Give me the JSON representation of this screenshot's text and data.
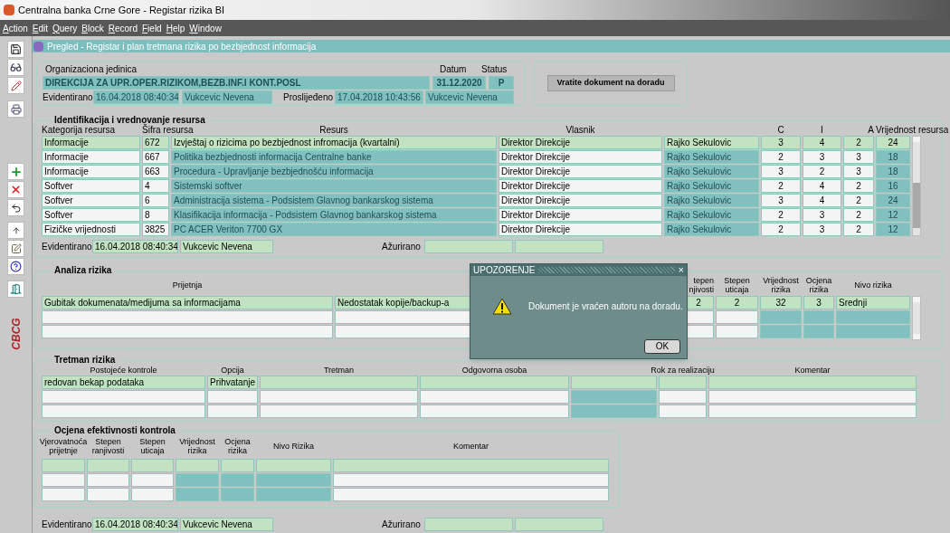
{
  "window": {
    "title": "Centralna banka Crne Gore - Registar rizika BI"
  },
  "menu": [
    "Action",
    "Edit",
    "Query",
    "Block",
    "Record",
    "Field",
    "Help",
    "Window"
  ],
  "side_logo": "CBCG",
  "form": {
    "title": "Pregled - Registar i plan tretmana rizika po bezbjednost informacija"
  },
  "header": {
    "org_label": "Organizaciona jedinica",
    "org_value": "DIREKCIJA ZA UPR.OPER.RIZIKOM,BEZB.INF.I KONT.POSL",
    "date_label": "Datum",
    "date_value": "31.12.2020",
    "status_label": "Status",
    "status_value": "P",
    "recorded_label": "Evidentirano",
    "recorded_at": "16.04.2018 08:40:34",
    "recorded_by": "Vukcevic Nevena",
    "forwarded_label": "Proslijeđeno",
    "forwarded_at": "17.04.2018 10:43:56",
    "forwarded_by": "Vukcevic Nevena"
  },
  "return_button": "Vratite dokument na doradu",
  "resources": {
    "title": "Identifikacija i vrednovanje resursa",
    "columns": [
      {
        "label": "Kategorija resursa",
        "readonly": false
      },
      {
        "label": "Šifra resursa",
        "readonly": false
      },
      {
        "label": "Resurs",
        "readonly": true
      },
      {
        "label": "Vlasnik",
        "readonly": false
      },
      {
        "readonly": true
      },
      {
        "label": "C",
        "readonly": false
      },
      {
        "label": "I",
        "readonly": false
      },
      {
        "label": "A",
        "readonly": false
      },
      {
        "label": "Vrijednost resursa",
        "readonly": true
      }
    ],
    "rows": [
      {
        "selected": true,
        "cells": [
          "Informacije",
          "672",
          "Izvještaj o rizicima po bezbjednost infromacija (kvartalni)",
          "Direktor Direkcije",
          "Rajko Sekulovic",
          "3",
          "4",
          "2",
          "24"
        ]
      },
      {
        "selected": false,
        "cells": [
          "Informacije",
          "667",
          "Politika bezbjednosti informacija Centralne banke",
          "Direktor Direkcije",
          "Rajko Sekulovic",
          "2",
          "3",
          "3",
          "18"
        ]
      },
      {
        "selected": false,
        "cells": [
          "Informacije",
          "663",
          "Procedura - Upravljanje bezbjednošću informacija",
          "Direktor Direkcije",
          "Rajko Sekulovic",
          "3",
          "2",
          "3",
          "18"
        ]
      },
      {
        "selected": false,
        "cells": [
          "Softver",
          "4",
          "Sistemski softver",
          "Direktor Direkcije",
          "Rajko Sekulovic",
          "2",
          "4",
          "2",
          "16"
        ]
      },
      {
        "selected": false,
        "cells": [
          "Softver",
          "6",
          "Administracija sistema - Podsistem Glavnog bankarskog sistema",
          "Direktor Direkcije",
          "Rajko Sekulovic",
          "3",
          "4",
          "2",
          "24"
        ]
      },
      {
        "selected": false,
        "cells": [
          "Softver",
          "8",
          "Klasifikacija informacija - Podsistem Glavnog bankarskog sistema",
          "Direktor Direkcije",
          "Rajko Sekulovic",
          "2",
          "3",
          "2",
          "12"
        ]
      },
      {
        "selected": false,
        "cells": [
          "Fizičke vrijednosti",
          "3825",
          "PC ACER Veriton 7700 GX",
          "Direktor Direkcije",
          "Rajko Sekulovic",
          "2",
          "3",
          "2",
          "12"
        ]
      }
    ],
    "footer": {
      "recorded_label": "Evidentirano",
      "recorded_at": "16.04.2018 08:40:34",
      "recorded_by": "Vukcevic Nevena",
      "updated_label": "Ažurirano"
    }
  },
  "analysis": {
    "title": "Analiza rizika",
    "columns": [
      {
        "label": [
          "Prijetnja"
        ],
        "readonly": false
      },
      {
        "readonly": false
      },
      {
        "label": [
          "tepen",
          "njivosti"
        ],
        "readonly": false
      },
      {
        "label": [
          "Stepen",
          "uticaja"
        ],
        "readonly": false
      },
      {
        "label": [
          "Vrijednost",
          "rizika"
        ],
        "readonly": true
      },
      {
        "label": [
          "Ocjena",
          "rizika"
        ],
        "readonly": true
      },
      {
        "label": [
          "Nivo rizika"
        ],
        "readonly": true
      }
    ],
    "rows": [
      {
        "selected": true,
        "cells": [
          "Gubitak dokumenata/medijuma sa informacijama",
          "Nedostatak kopije/backup-a",
          "2",
          "2",
          "32",
          "3",
          "Srednji"
        ]
      },
      {
        "selected": false,
        "cells": [
          "",
          "",
          "",
          "",
          "",
          "",
          ""
        ]
      },
      {
        "selected": false,
        "cells": [
          "",
          "",
          "",
          "",
          "",
          "",
          ""
        ]
      }
    ]
  },
  "treatment": {
    "title": "Tretman rizika",
    "columns": [
      {
        "label": "Postojeće kontrole",
        "readonly": false
      },
      {
        "label": "Opcija",
        "readonly": false
      },
      {
        "label": "Tretman",
        "readonly": false
      },
      {
        "label": "Odgovorna osoba",
        "readonly": false
      },
      {
        "readonly": true
      },
      {
        "label": "Rok za realizaciju",
        "readonly": false
      },
      {
        "label": "Komentar",
        "readonly": false
      }
    ],
    "rows": [
      {
        "selected": true,
        "cells": [
          "redovan bekap podataka",
          "Prihvatanje",
          "",
          "",
          "",
          "",
          ""
        ]
      },
      {
        "selected": false,
        "cells": [
          "",
          "",
          "",
          "",
          "",
          "",
          ""
        ]
      },
      {
        "selected": false,
        "cells": [
          "",
          "",
          "",
          "",
          "",
          "",
          ""
        ]
      }
    ]
  },
  "effectiveness": {
    "title": "Ocjena efektivnosti kontrola",
    "columns": [
      {
        "label": [
          "Vjerovatnoća",
          "prijetnje"
        ],
        "readonly": false
      },
      {
        "label": [
          "Stepen",
          "ranjivosti"
        ],
        "readonly": false
      },
      {
        "label": [
          "Stepen",
          "uticaja"
        ],
        "readonly": false
      },
      {
        "label": [
          "Vrijednost",
          "rizika"
        ],
        "readonly": true
      },
      {
        "label": [
          "Ocjena",
          "rizika"
        ],
        "readonly": true
      },
      {
        "label": [
          "Nivo Rizika"
        ],
        "readonly": true
      },
      {
        "label": [
          "Komentar"
        ],
        "readonly": false
      }
    ],
    "rows": [
      {
        "selected": true,
        "cells": [
          "",
          "",
          "",
          "",
          "",
          "",
          ""
        ]
      },
      {
        "selected": false,
        "cells": [
          "",
          "",
          "",
          "",
          "",
          "",
          ""
        ]
      },
      {
        "selected": false,
        "cells": [
          "",
          "",
          "",
          "",
          "",
          "",
          ""
        ]
      }
    ],
    "footer": {
      "recorded_label": "Evidentirano",
      "recorded_at": "16.04.2018 08:40:34",
      "recorded_by": "Vukcevic Nevena",
      "updated_label": "Ažurirano"
    }
  },
  "dialog": {
    "title": "UPOZORENJE",
    "close": "×",
    "message": "Dokument je vraćen autoru na doradu.",
    "ok": "OK"
  }
}
